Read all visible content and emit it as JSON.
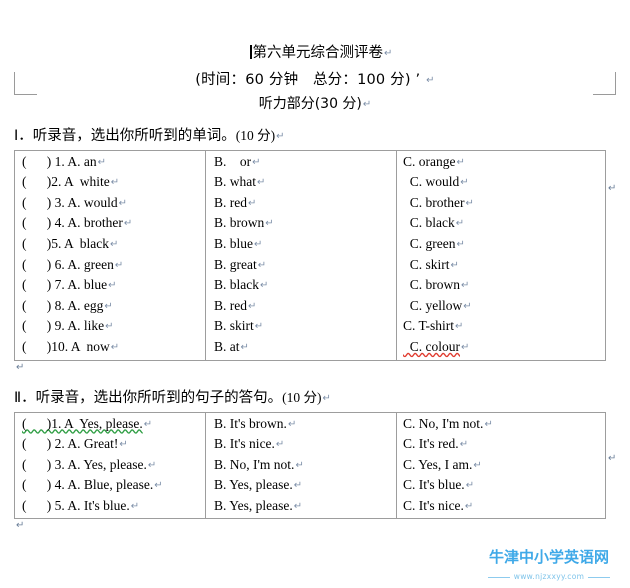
{
  "document": {
    "title": "第六单元综合测评卷",
    "subtitle": "(时间：60 分钟　总分：100 分)",
    "subtitle_trailing": "’",
    "listening_part": "听力部分(30 分)",
    "pilcrow": "↵"
  },
  "sections": [
    {
      "label": "Ⅰ．",
      "heading": "听录音，选出你所听到的单词。",
      "points": "(10 分)",
      "rows": [
        {
          "a": "(      ) 1. A. an",
          "b": "B.    or",
          "c": "C. orange"
        },
        {
          "a": "(      )2. A  white",
          "b": "B. what",
          "c": "  C. would"
        },
        {
          "a": "(      ) 3. A. would",
          "b": "B. red",
          "c": "  C. brother"
        },
        {
          "a": "(      ) 4. A. brother",
          "b": "B. brown",
          "c": "  C. black"
        },
        {
          "a": "(      )5. A  black",
          "b": "B. blue",
          "c": "  C. green"
        },
        {
          "a": "(      ) 6. A. green",
          "b": "B. great",
          "c": "  C. skirt"
        },
        {
          "a": "(      ) 7. A. blue",
          "b": "B. black",
          "c": "  C. brown"
        },
        {
          "a": "(      ) 8. A. egg",
          "b": "B. red",
          "c": "  C. yellow"
        },
        {
          "a": "(      ) 9. A. like",
          "b": "B. skirt",
          "c": "C. T-shirt"
        },
        {
          "a": "(      )10. A  now",
          "b": "B. at",
          "c": "  C. colour",
          "c_misspelled": "colour"
        }
      ],
      "empty_row": {
        "a": "↵",
        "b": "↵",
        "c": ""
      }
    },
    {
      "label": "Ⅱ．",
      "heading": "听录音，选出你所听到的句子的答句。",
      "points": "(10 分)",
      "rows": [
        {
          "a": "(      )1. A  Yes, please.",
          "a_grammar": "1.",
          "b": "B. It's brown.",
          "c": "C. No, I'm not."
        },
        {
          "a": "(      ) 2. A. Great!",
          "b": "B. It's nice.",
          "c": "C. It's red."
        },
        {
          "a": "(      ) 3. A. Yes, please.",
          "b": "B. No, I'm not.",
          "c": "C. Yes, I am."
        },
        {
          "a": "(      ) 4. A. Blue, please.",
          "b": "B. Yes, please.",
          "c": "C. It's blue."
        },
        {
          "a": "(      ) 5. A. It's blue.",
          "b": "B. Yes, please.",
          "c": "C. It's nice."
        }
      ],
      "empty_row": {
        "a": "↵",
        "b": "↵",
        "c": ""
      }
    }
  ],
  "watermark": {
    "title": "牛津中小学英语网",
    "url": "www.njzxxyy.com",
    "color": "#3fa9e8"
  },
  "marks": {
    "pilcrow": "↵",
    "pilcrow_alt": "↵"
  }
}
